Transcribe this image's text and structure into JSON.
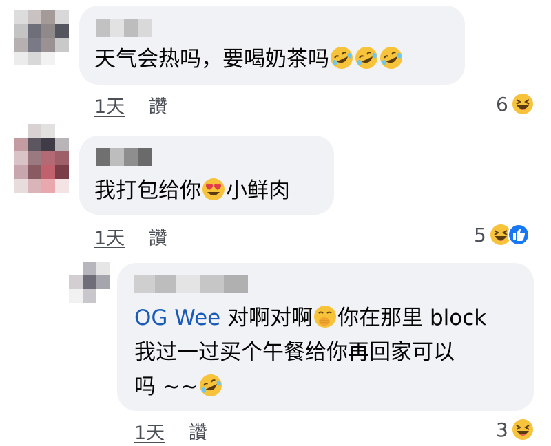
{
  "comments": [
    {
      "text": "天气会热吗，要喝奶茶吗",
      "time": "1天",
      "action": "讚",
      "reaction_count": "6",
      "reactions": [
        "laughing-emoji"
      ],
      "inline_emojis": [
        "rofl-emoji",
        "rofl-emoji",
        "rofl-emoji"
      ]
    },
    {
      "text_before": "我打包给你",
      "text_after": "小鲜肉",
      "time": "1天",
      "action": "讚",
      "reaction_count": "5",
      "reactions": [
        "laughing-emoji",
        "like-emoji"
      ],
      "inline_emojis": [
        "heart-eyes-emoji"
      ]
    },
    {
      "mention": "OG Wee",
      "line1_after_mention": " 对啊对啊",
      "line1_end": "你在那里 block",
      "line2": "我过一过买个午餐给你再回家可以",
      "line3": "吗 ~~",
      "time": "1天",
      "action": "讚",
      "reaction_count": "3",
      "reactions": [
        "laughing-emoji"
      ],
      "inline_emojis": [
        "face-with-hand-over-mouth-emoji",
        "rofl-emoji"
      ]
    }
  ],
  "colors": {
    "bubble": "#f0f2f5",
    "mention": "#1a5bb8",
    "meta": "#4b4f56",
    "like_blue": "#1877f2",
    "emoji_yellow": "#f7c33b"
  }
}
